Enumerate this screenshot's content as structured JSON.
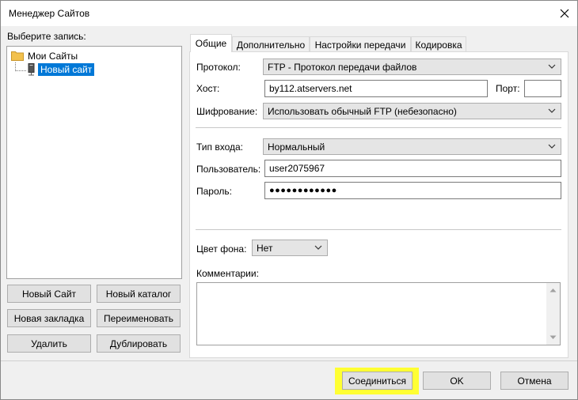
{
  "window": {
    "title": "Менеджер Сайтов"
  },
  "sidebar": {
    "label": "Выберите запись:",
    "tree": {
      "root": "Мои Сайты",
      "child": "Новый сайт"
    },
    "buttons": {
      "new_site": "Новый Сайт",
      "new_folder": "Новый каталог",
      "new_bookmark": "Новая закладка",
      "rename": "Переименовать",
      "delete": "Удалить",
      "duplicate": "Дублировать"
    }
  },
  "tabs": [
    "Общие",
    "Дополнительно",
    "Настройки передачи",
    "Кодировка"
  ],
  "general": {
    "protocol_label": "Протокол:",
    "protocol_value": "FTP - Протокол передачи файлов",
    "host_label": "Хост:",
    "host_value": "by112.atservers.net",
    "port_label": "Порт:",
    "port_value": "",
    "encryption_label": "Шифрование:",
    "encryption_value": "Использовать обычный FTP (небезопасно)",
    "logon_label": "Тип входа:",
    "logon_value": "Нормальный",
    "user_label": "Пользователь:",
    "user_value": "user2075967",
    "password_label": "Пароль:",
    "password_value": "●●●●●●●●●●●●",
    "bgcolor_label": "Цвет фона:",
    "bgcolor_value": "Нет",
    "comments_label": "Комментарии:",
    "comments_value": ""
  },
  "footer": {
    "connect": "Соединиться",
    "ok": "OK",
    "cancel": "Отмена"
  },
  "colors": {
    "selection": "#0078d7",
    "highlight": "#ffff33",
    "folder": "#f2c14e"
  },
  "icons": {
    "close": "close-icon",
    "folder": "folder-icon",
    "server": "server-icon",
    "dropdown": "chevron-down-icon"
  }
}
